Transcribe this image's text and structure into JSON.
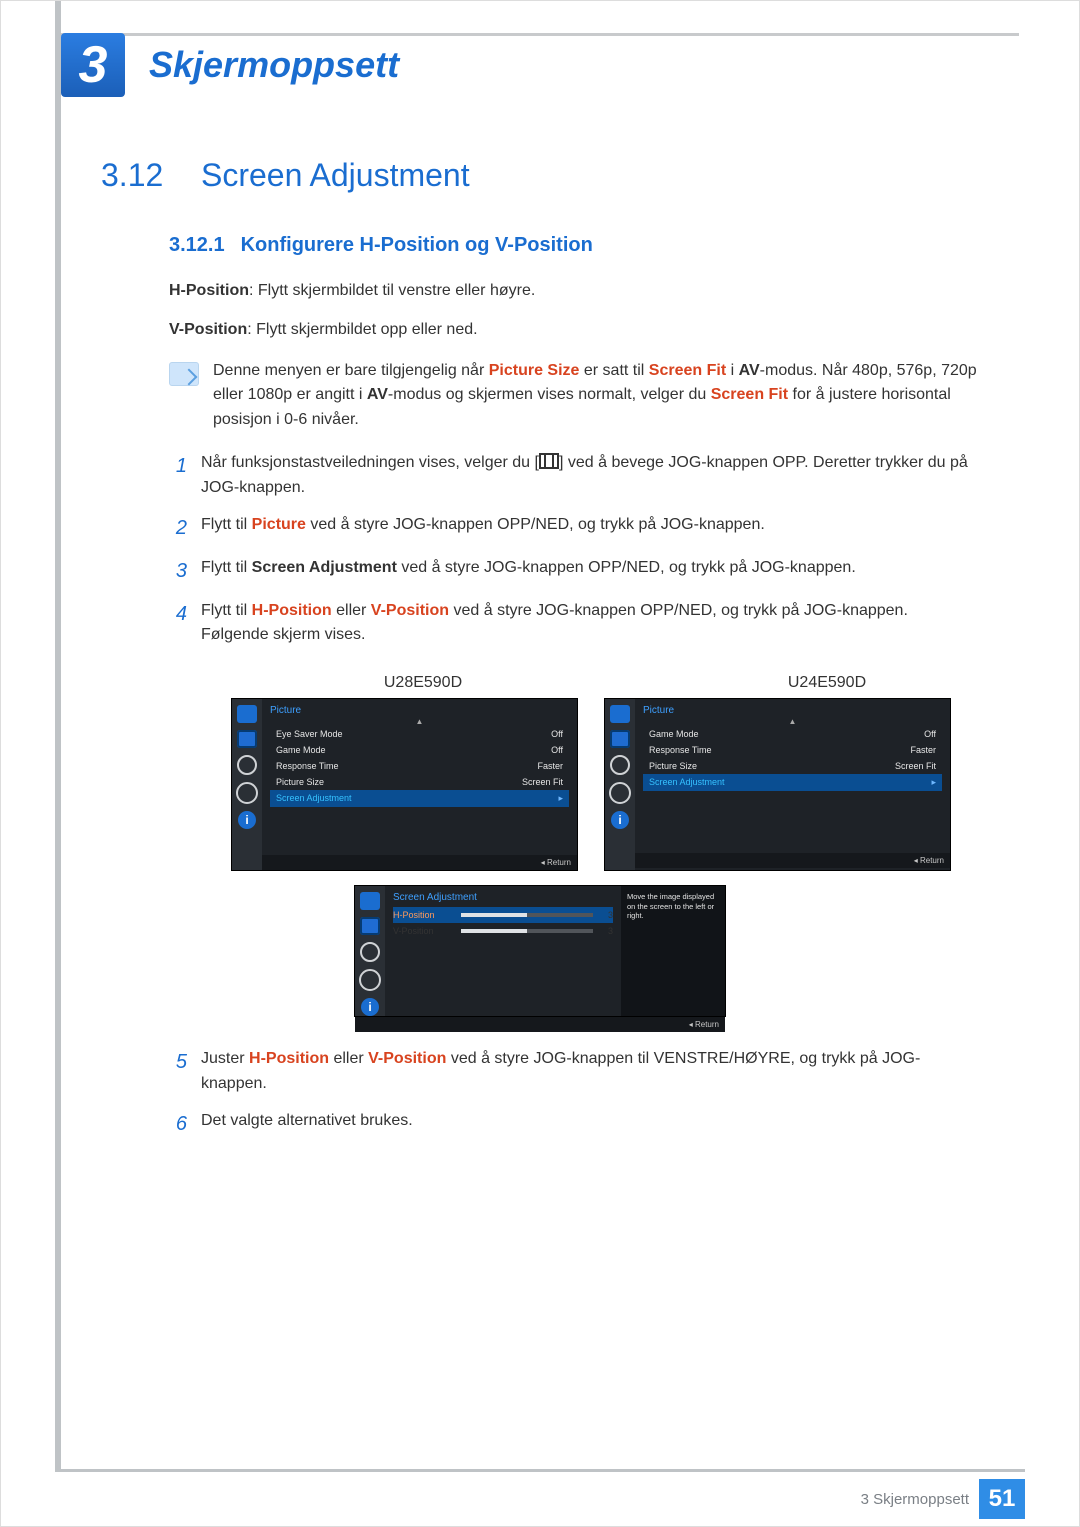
{
  "chapter": {
    "num": "3",
    "title": "Skjermoppsett"
  },
  "section": {
    "num": "3.12",
    "title": "Screen Adjustment"
  },
  "subsection": {
    "num": "3.12.1",
    "title": "Konfigurere H-Position og V-Position"
  },
  "hpos_label": "H-Position",
  "hpos_text": ": Flytt skjermbildet til venstre eller høyre.",
  "vpos_label": "V-Position",
  "vpos_text": ": Flytt skjermbildet opp eller ned.",
  "note": {
    "t1": "Denne menyen er bare tilgjengelig når ",
    "ps": "Picture Size",
    "t2": " er satt til ",
    "sf": "Screen Fit",
    "t3": " i ",
    "av": "AV",
    "t4": "-modus. Når 480p, 576p, 720p eller 1080p er angitt i ",
    "t5": "-modus og skjermen vises normalt, velger du ",
    "t6": " for å justere horisontal posisjon i 0-6 nivåer."
  },
  "steps": {
    "s1a": "Når funksjonstastveiledningen vises, velger du [",
    "s1b": "] ved å bevege JOG-knappen OPP. Deretter trykker du på JOG-knappen.",
    "s2a": "Flytt til ",
    "s2pic": "Picture",
    "s2b": " ved å styre JOG-knappen OPP/NED, og trykk på JOG-knappen.",
    "s3a": "Flytt til ",
    "s3sa": "Screen Adjustment",
    "s3b": " ved å styre JOG-knappen OPP/NED, og trykk på JOG-knappen.",
    "s4a": "Flytt til ",
    "s4h": "H-Position",
    "s4or": " eller ",
    "s4v": "V-Position",
    "s4b": " ved å styre JOG-knappen OPP/NED, og trykk på JOG-knappen. Følgende skjerm vises.",
    "s5a": "Juster ",
    "s5b": " ved å styre JOG-knappen til VENSTRE/HØYRE, og trykk på JOG-knappen.",
    "s6": "Det valgte alternativet brukes."
  },
  "models": {
    "a": "U28E590D",
    "b": "U24E590D"
  },
  "menu1": {
    "title": "Picture",
    "rows": [
      {
        "lab": "Eye Saver Mode",
        "val": "Off"
      },
      {
        "lab": "Game Mode",
        "val": "Off"
      },
      {
        "lab": "Response Time",
        "val": "Faster"
      },
      {
        "lab": "Picture Size",
        "val": "Screen Fit"
      }
    ],
    "sel": "Screen Adjustment",
    "ret": "Return"
  },
  "menu2": {
    "title": "Picture",
    "rows": [
      {
        "lab": "Game Mode",
        "val": "Off"
      },
      {
        "lab": "Response Time",
        "val": "Faster"
      },
      {
        "lab": "Picture Size",
        "val": "Screen Fit"
      }
    ],
    "sel": "Screen Adjustment",
    "ret": "Return"
  },
  "menu3": {
    "title": "Screen Adjustment",
    "h": {
      "lab": "H-Position",
      "val": "3"
    },
    "v": {
      "lab": "V-Position",
      "val": "3"
    },
    "tip": "Move the image displayed on the screen to the left or right.",
    "ret": "Return"
  },
  "footer": {
    "text": "3 Skjermoppsett",
    "page": "51"
  }
}
